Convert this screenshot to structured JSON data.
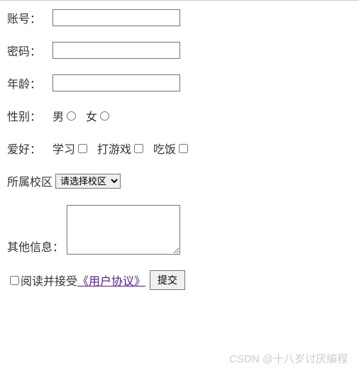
{
  "form": {
    "account": {
      "label": "账号：",
      "value": ""
    },
    "password": {
      "label": "密码：",
      "value": ""
    },
    "age": {
      "label": "年龄：",
      "value": ""
    },
    "gender": {
      "label": "性别：",
      "options": [
        {
          "label": "男"
        },
        {
          "label": "女"
        }
      ]
    },
    "hobby": {
      "label": "爱好：",
      "options": [
        {
          "label": "学习"
        },
        {
          "label": "打游戏"
        },
        {
          "label": "吃饭"
        }
      ]
    },
    "campus": {
      "label": "所属校区",
      "selected": "请选择校区"
    },
    "other": {
      "label": "其他信息：",
      "value": ""
    },
    "agreement": {
      "text": "阅读并接受",
      "link_text": "《用户协议》"
    },
    "submit_label": "提交"
  },
  "watermark": "CSDN @十八岁讨厌编程"
}
